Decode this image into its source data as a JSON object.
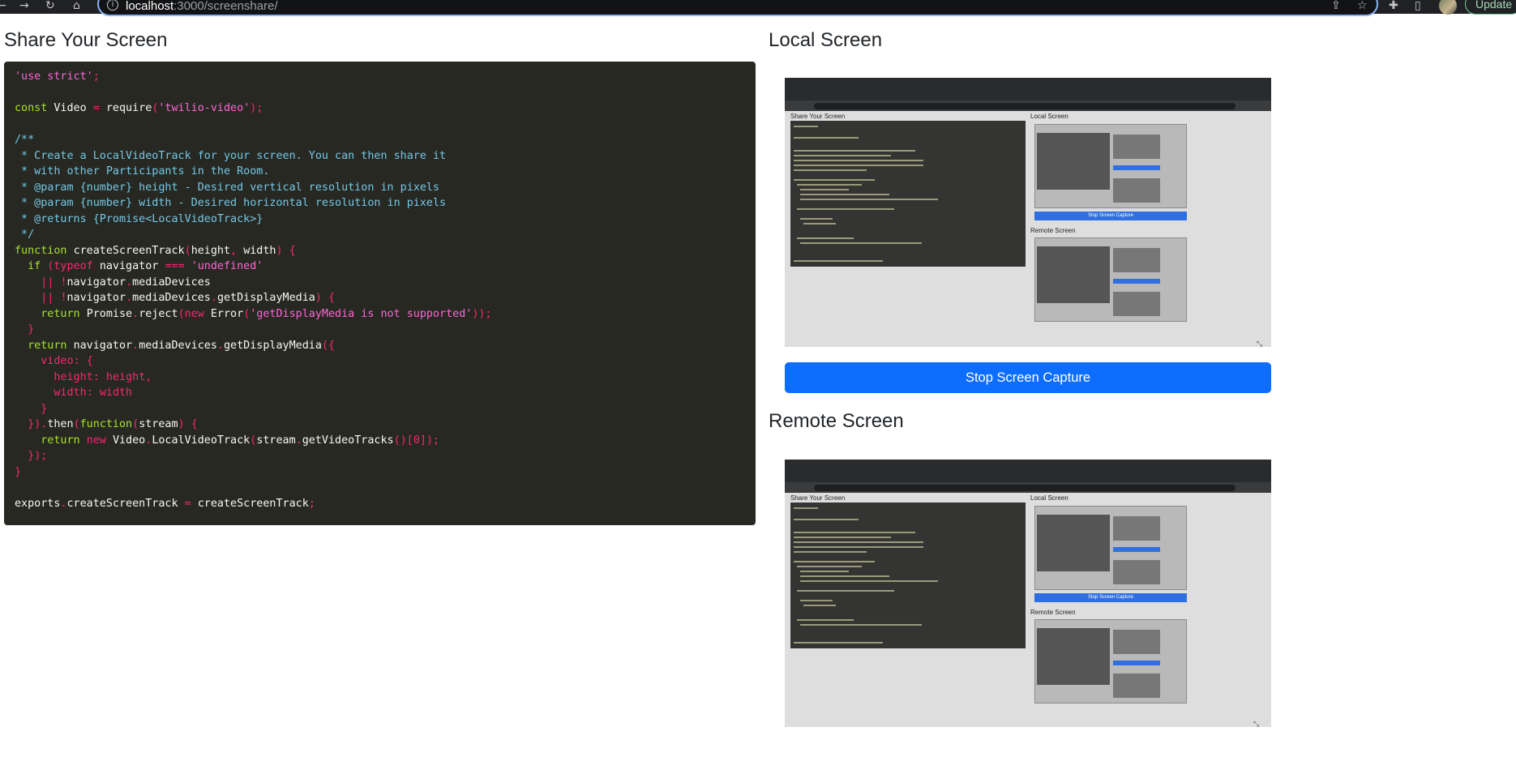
{
  "browser": {
    "url_host": "localhost",
    "url_path": ":3000/screenshare/",
    "update_label": "Update",
    "icons": [
      "back-arrow-icon",
      "forward-arrow-icon",
      "reload-icon",
      "home-icon",
      "info-icon",
      "share-icon",
      "star-icon",
      "extensions-icon",
      "side-panel-icon",
      "avatar"
    ]
  },
  "left": {
    "heading": "Share Your Screen",
    "code_lines": [
      "'use strict';",
      "",
      "const Video = require('twilio-video');",
      "",
      "/**",
      " * Create a LocalVideoTrack for your screen. You can then share it",
      " * with other Participants in the Room.",
      " * @param {number} height - Desired vertical resolution in pixels",
      " * @param {number} width - Desired horizontal resolution in pixels",
      " * @returns {Promise<LocalVideoTrack>}",
      " */",
      "function createScreenTrack(height, width) {",
      "  if (typeof navigator === 'undefined'",
      "    || !navigator.mediaDevices",
      "    || !navigator.mediaDevices.getDisplayMedia) {",
      "    return Promise.reject(new Error('getDisplayMedia is not supported'));",
      "  }",
      "  return navigator.mediaDevices.getDisplayMedia({",
      "    video: {",
      "      height: height,",
      "      width: width",
      "    }",
      "  }).then(function(stream) {",
      "    return new Video.LocalVideoTrack(stream.getVideoTracks()[0]);",
      "  });",
      "}",
      "",
      "exports.createScreenTrack = createScreenTrack;"
    ]
  },
  "right": {
    "local_heading": "Local Screen",
    "remote_heading": "Remote Screen",
    "stop_button_label": "Stop Screen Capture",
    "mirror": {
      "share_heading": "Share Your Screen",
      "local_heading": "Local Screen",
      "remote_heading": "Remote Screen",
      "stop_label": "Stop Screen Capture"
    }
  },
  "colors": {
    "primary": "#0d6efd",
    "code_bg": "#272822"
  }
}
